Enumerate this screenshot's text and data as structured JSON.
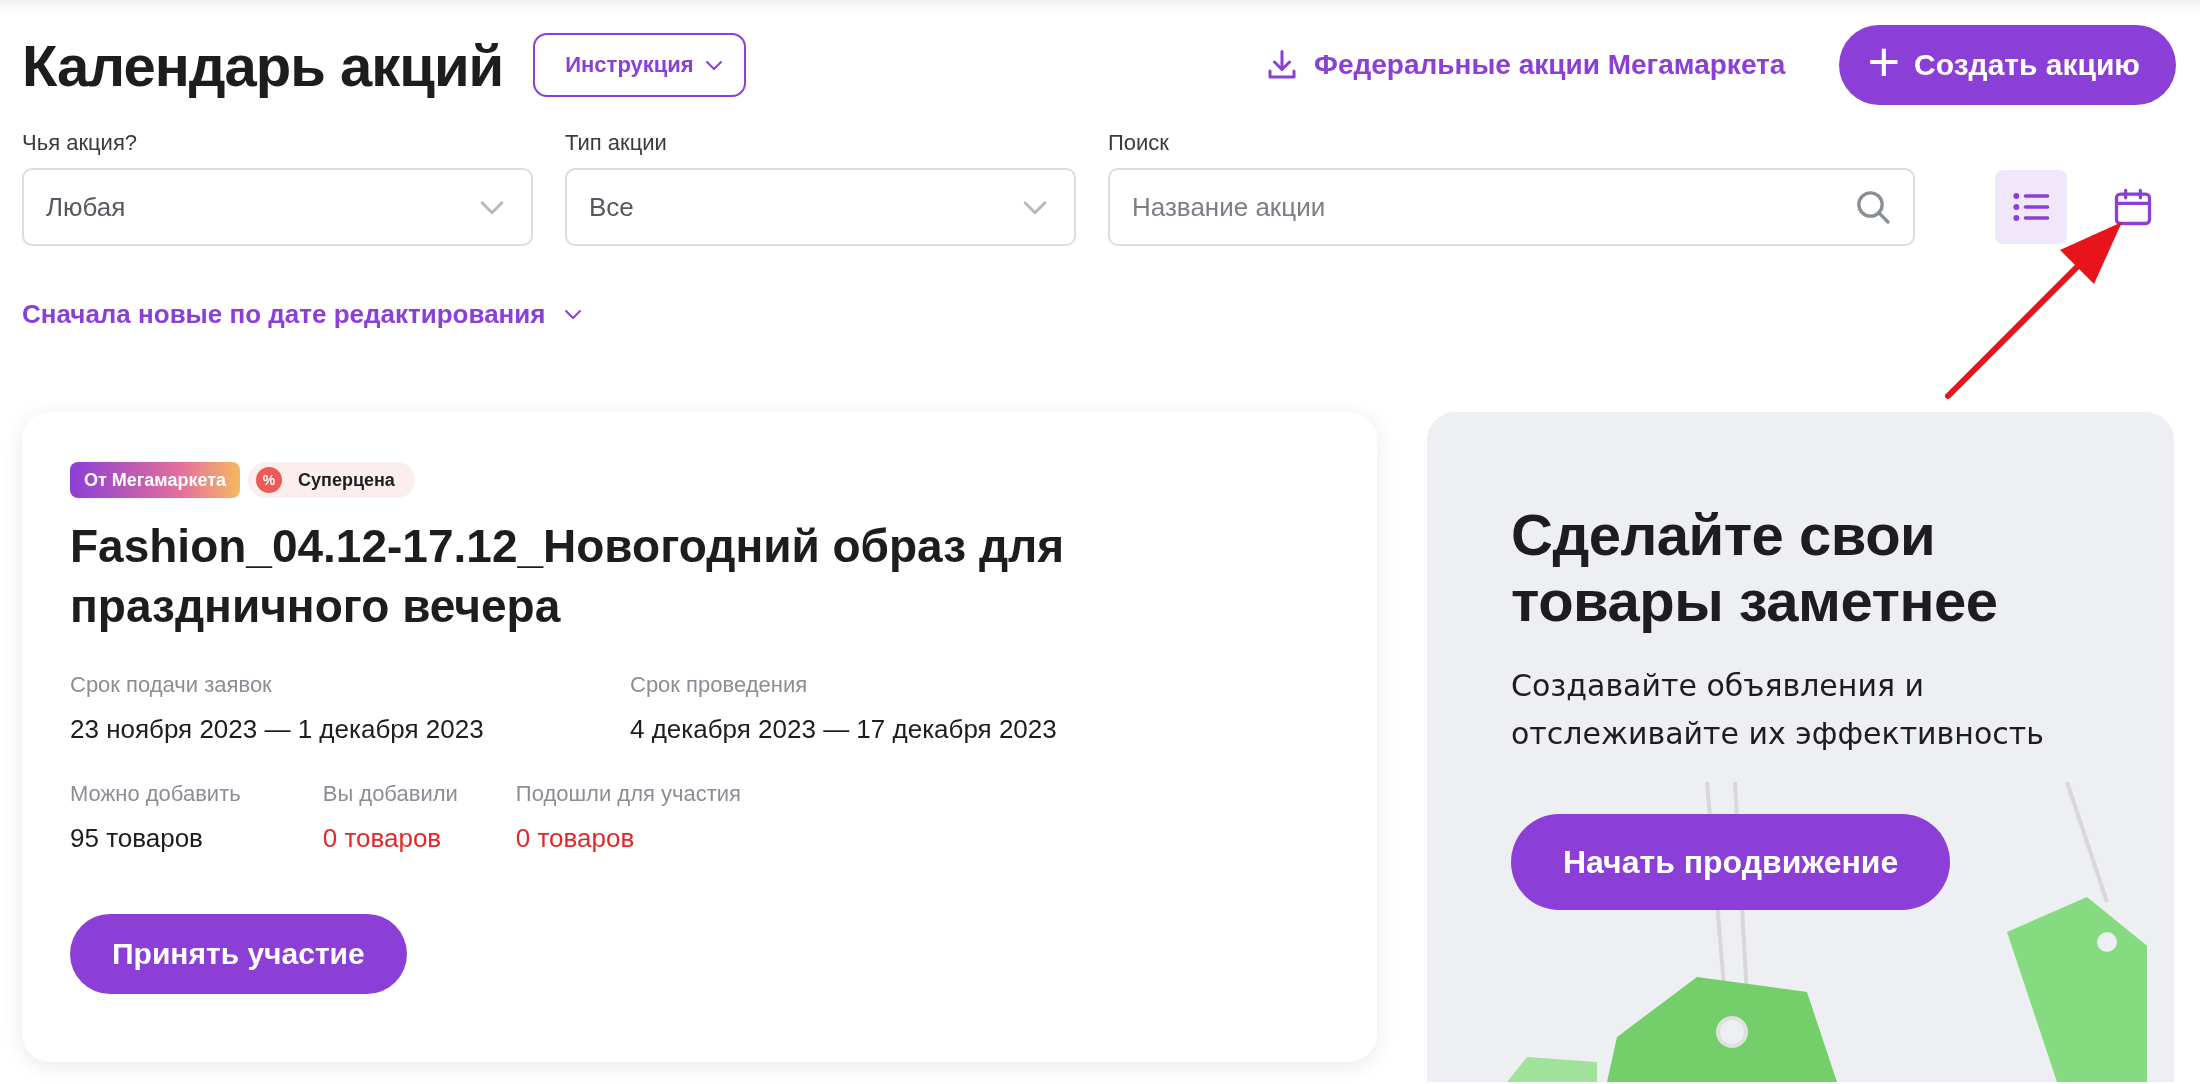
{
  "header": {
    "title": "Календарь акций",
    "instruction_button": "Инструкция",
    "federal_link": "Федеральные акции Мегамаркета",
    "create_button": {
      "icon": "+",
      "label": "Создать акцию"
    }
  },
  "filters": [
    {
      "kind": "select",
      "label": "Чья акция?",
      "value": "Любая"
    },
    {
      "kind": "select",
      "label": "Тип акции",
      "value": "Все"
    },
    {
      "kind": "search",
      "label": "Поиск",
      "placeholder": "Название акции"
    }
  ],
  "view_toggles": [
    {
      "kind": "list",
      "selected": true
    },
    {
      "kind": "calendar",
      "selected": false
    }
  ],
  "sort": {
    "label": "Сначала новые по дате редактирования"
  },
  "promo_card": {
    "badges": [
      {
        "kind": "source",
        "label": "От Мегамаркета"
      },
      {
        "kind": "promo",
        "icon": "%",
        "label": "Суперцена"
      }
    ],
    "title": "Fashion_04.12-17.12_Новогодний образ для праздничного вечера",
    "dates": [
      {
        "label": "Срок подачи заявок",
        "value": "23 ноября 2023 — 1 декабря 2023"
      },
      {
        "label": "Срок проведения",
        "value": "4 декабря 2023 — 17 декабря 2023"
      }
    ],
    "counts": [
      {
        "label": "Можно добавить",
        "value": "95 товаров",
        "alert": false
      },
      {
        "label": "Вы добавили",
        "value": "0 товаров",
        "alert": true
      },
      {
        "label": "Подошли для участия",
        "value": "0 товаров",
        "alert": true
      }
    ],
    "button": "Принять участие"
  },
  "ad_banner": {
    "title": "Сделайте свои товары заметнее",
    "text": "Создавайте объявления и отслеживайте их эффективность",
    "button": "Начать продвижение"
  }
}
